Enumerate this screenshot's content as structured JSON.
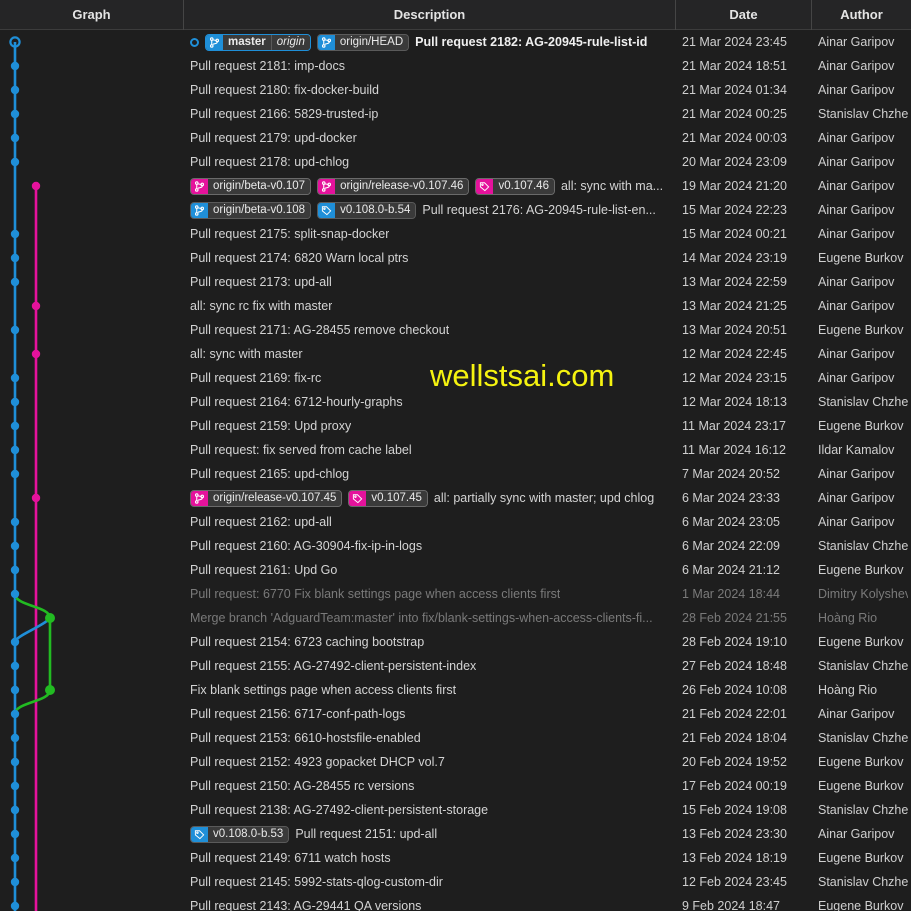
{
  "columns": [
    {
      "key": "graph",
      "label": "Graph"
    },
    {
      "key": "desc",
      "label": "Description"
    },
    {
      "key": "date",
      "label": "Date"
    },
    {
      "key": "author",
      "label": "Author"
    }
  ],
  "watermark": "wellstsai.com",
  "colors": {
    "background": "#1e1e1e",
    "header_background": "#252526",
    "text": "#d4d4d4",
    "dim_text": "#7a7a7a",
    "branch_blue": "#1f8fd8",
    "branch_magenta": "#e5129c",
    "branch_green": "#22bb22",
    "badge_background": "#3a3a3a",
    "watermark": "#f5f310"
  },
  "rows": [
    {
      "refs": [
        {
          "type": "branch",
          "name": "master",
          "remote": "origin",
          "color": "blue",
          "current": true
        },
        {
          "type": "branch",
          "name": "origin/HEAD",
          "color": "blue",
          "current": false
        }
      ],
      "head": true,
      "message": "Pull request 2182: AG-20945-rule-list-id",
      "bold": true,
      "date": "21 Mar 2024 23:45",
      "author": "Ainar Garipov"
    },
    {
      "message": "Pull request 2181: imp-docs",
      "date": "21 Mar 2024 18:51",
      "author": "Ainar Garipov"
    },
    {
      "message": "Pull request 2180: fix-docker-build",
      "date": "21 Mar 2024 01:34",
      "author": "Ainar Garipov"
    },
    {
      "message": "Pull request 2166: 5829-trusted-ip",
      "date": "21 Mar 2024 00:25",
      "author": "Stanislav Chzhen"
    },
    {
      "message": "Pull request 2179: upd-docker",
      "date": "21 Mar 2024 00:03",
      "author": "Ainar Garipov"
    },
    {
      "message": "Pull request 2178: upd-chlog",
      "date": "20 Mar 2024 23:09",
      "author": "Ainar Garipov"
    },
    {
      "refs": [
        {
          "type": "branch",
          "name": "origin/beta-v0.107",
          "color": "magenta"
        },
        {
          "type": "branch",
          "name": "origin/release-v0.107.46",
          "color": "magenta"
        },
        {
          "type": "tag",
          "name": "v0.107.46",
          "color": "magenta"
        }
      ],
      "message": "all: sync with ma...",
      "date": "19 Mar 2024 21:20",
      "author": "Ainar Garipov"
    },
    {
      "refs": [
        {
          "type": "branch",
          "name": "origin/beta-v0.108",
          "color": "blue"
        },
        {
          "type": "tag",
          "name": "v0.108.0-b.54",
          "color": "blue"
        }
      ],
      "message": "Pull request 2176: AG-20945-rule-list-en...",
      "date": "15 Mar 2024 22:23",
      "author": "Ainar Garipov"
    },
    {
      "message": "Pull request 2175: split-snap-docker",
      "date": "15 Mar 2024 00:21",
      "author": "Ainar Garipov"
    },
    {
      "message": "Pull request 2174: 6820 Warn local ptrs",
      "date": "14 Mar 2024 23:19",
      "author": "Eugene Burkov"
    },
    {
      "message": "Pull request 2173: upd-all",
      "date": "13 Mar 2024 22:59",
      "author": "Ainar Garipov"
    },
    {
      "message": "all: sync rc fix with master",
      "date": "13 Mar 2024 21:25",
      "author": "Ainar Garipov"
    },
    {
      "message": "Pull request 2171: AG-28455 remove checkout",
      "date": "13 Mar 2024 20:51",
      "author": "Eugene Burkov"
    },
    {
      "message": "all: sync with master",
      "date": "12 Mar 2024 22:45",
      "author": "Ainar Garipov"
    },
    {
      "message": "Pull request 2169: fix-rc",
      "date": "12 Mar 2024 23:15",
      "author": "Ainar Garipov"
    },
    {
      "message": "Pull request 2164: 6712-hourly-graphs",
      "date": "12 Mar 2024 18:13",
      "author": "Stanislav Chzhen"
    },
    {
      "message": "Pull request 2159: Upd proxy",
      "date": "11 Mar 2024 23:17",
      "author": "Eugene Burkov"
    },
    {
      "message": "Pull request: fix served from cache label",
      "date": "11 Mar 2024 16:12",
      "author": "Ildar Kamalov"
    },
    {
      "message": "Pull request 2165: upd-chlog",
      "date": "7 Mar 2024 20:52",
      "author": "Ainar Garipov"
    },
    {
      "refs": [
        {
          "type": "branch",
          "name": "origin/release-v0.107.45",
          "color": "magenta"
        },
        {
          "type": "tag",
          "name": "v0.107.45",
          "color": "magenta"
        }
      ],
      "message": "all: partially sync with master; upd chlog",
      "date": "6 Mar 2024 23:33",
      "author": "Ainar Garipov"
    },
    {
      "message": "Pull request 2162: upd-all",
      "date": "6 Mar 2024 23:05",
      "author": "Ainar Garipov"
    },
    {
      "message": "Pull request 2160: AG-30904-fix-ip-in-logs",
      "date": "6 Mar 2024 22:09",
      "author": "Stanislav Chzhen"
    },
    {
      "message": "Pull request 2161: Upd Go",
      "date": "6 Mar 2024 21:12",
      "author": "Eugene Burkov"
    },
    {
      "message": "Pull request: 6770 Fix blank settings page when access clients first",
      "dim": true,
      "date": "1 Mar 2024 18:44",
      "author": "Dimitry Kolyshev"
    },
    {
      "message": "Merge branch 'AdguardTeam:master' into fix/blank-settings-when-access-clients-fi...",
      "dim": true,
      "date": "28 Feb 2024 21:55",
      "author": "Hoàng Rio"
    },
    {
      "message": "Pull request 2154: 6723 caching bootstrap",
      "date": "28 Feb 2024 19:10",
      "author": "Eugene Burkov"
    },
    {
      "message": "Pull request 2155: AG-27492-client-persistent-index",
      "date": "27 Feb 2024 18:48",
      "author": "Stanislav Chzhen"
    },
    {
      "message": "Fix blank settings page when access clients first",
      "date": "26 Feb 2024 10:08",
      "author": "Hoàng Rio"
    },
    {
      "message": "Pull request 2156: 6717-conf-path-logs",
      "date": "21 Feb 2024 22:01",
      "author": "Ainar Garipov"
    },
    {
      "message": "Pull request 2153: 6610-hostsfile-enabled",
      "date": "21 Feb 2024 18:04",
      "author": "Stanislav Chzhen"
    },
    {
      "message": "Pull request 2152: 4923 gopacket DHCP vol.7",
      "date": "20 Feb 2024 19:52",
      "author": "Eugene Burkov"
    },
    {
      "message": "Pull request 2150: AG-28455 rc versions",
      "date": "17 Feb 2024 00:19",
      "author": "Eugene Burkov"
    },
    {
      "message": "Pull request 2138: AG-27492-client-persistent-storage",
      "date": "15 Feb 2024 19:08",
      "author": "Stanislav Chzhen"
    },
    {
      "refs": [
        {
          "type": "tag",
          "name": "v0.108.0-b.53",
          "color": "blue"
        }
      ],
      "message": "Pull request 2151: upd-all",
      "date": "13 Feb 2024 23:30",
      "author": "Ainar Garipov"
    },
    {
      "message": "Pull request 2149: 6711 watch hosts",
      "date": "13 Feb 2024 18:19",
      "author": "Eugene Burkov"
    },
    {
      "message": "Pull request 2145: 5992-stats-qlog-custom-dir",
      "date": "12 Feb 2024 23:45",
      "author": "Stanislav Chzhen"
    },
    {
      "message": "Pull request 2143: AG-29441 QA versions",
      "date": "9 Feb 2024 18:47",
      "author": "Eugene Burkov"
    }
  ],
  "graph": {
    "lanes": [
      {
        "name": "main-lane-blue",
        "x": 15,
        "color": "#1f8fd8"
      },
      {
        "name": "release-lane-magenta",
        "x": 36,
        "color": "#e5129c"
      },
      {
        "name": "feature-lane-green",
        "x": 50,
        "color": "#22bb22"
      }
    ],
    "blue_nodes_rows": [
      0,
      1,
      2,
      3,
      4,
      5,
      8,
      9,
      10,
      12,
      14,
      15,
      16,
      17,
      18,
      20,
      21,
      22,
      23,
      25,
      26,
      27,
      28,
      29,
      30,
      31,
      32,
      33,
      34,
      35,
      36
    ],
    "magenta_nodes_rows": [
      6,
      11,
      13,
      19
    ],
    "green_nodes_rows": [
      24,
      27
    ],
    "head_node_row": 0
  }
}
